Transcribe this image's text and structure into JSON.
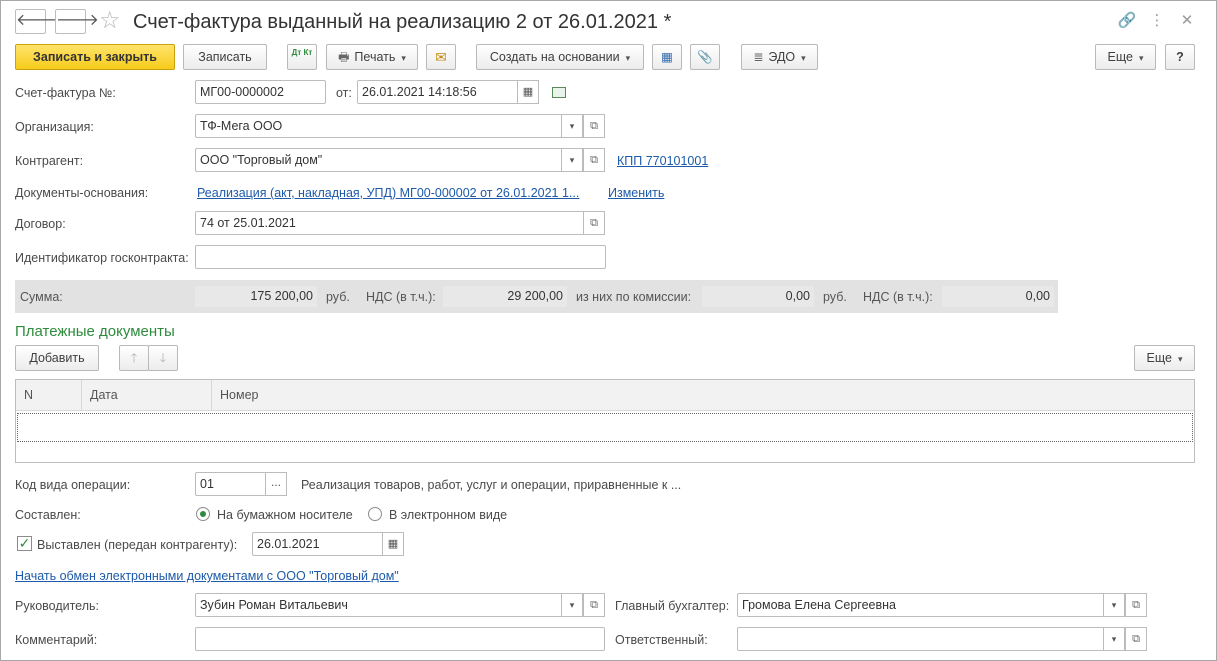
{
  "window": {
    "title": "Счет-фактура выданный на реализацию 2 от 26.01.2021 *",
    "back_glyph": "🡐",
    "forward_glyph": "🡒",
    "star_glyph": "☆",
    "link_glyph": "🔗",
    "menu_glyph": "⋮",
    "close_glyph": "✕"
  },
  "toolbar": {
    "save_close": "Записать и закрыть",
    "save": "Записать",
    "dtkt_icon": "Дт Кт",
    "print": "Печать",
    "print_glyph": "🖶",
    "mail_glyph": "✉",
    "create_based": "Создать на основании",
    "structure_glyph": "▦",
    "attach_glyph": "📎",
    "edo": "ЭДО",
    "edo_glyph": "≣",
    "more": "Еще",
    "help": "?",
    "caret": "▾"
  },
  "form": {
    "invoice_no_label": "Счет-фактура №:",
    "invoice_no": "МГ00-0000002",
    "from_label": "от:",
    "date": "26.01.2021 14:18:56",
    "calendar_glyph": "▦",
    "org_label": "Организация:",
    "org": "ТФ-Мега ООО",
    "counterparty_label": "Контрагент:",
    "counterparty": "ООО \"Торговый дом\"",
    "kpp_link": "КПП 770101001",
    "basis_label": "Документы-основания:",
    "basis_link": "Реализация (акт, накладная, УПД) МГ00-000002 от 26.01.2021 1...",
    "change_link": "Изменить",
    "contract_label": "Договор:",
    "contract": "74 от 25.01.2021",
    "gov_contract_label": "Идентификатор госконтракта:",
    "gov_contract": "",
    "open_glyph": "⧉",
    "dots": "..."
  },
  "totals": {
    "sum_label": "Сумма:",
    "sum": "175 200,00",
    "currency": "руб.",
    "vat_label": "НДС (в т.ч.):",
    "vat": "29 200,00",
    "commission_label": "из них по комиссии:",
    "commission": "0,00",
    "currency2": "руб.",
    "vat2_label": "НДС (в т.ч.):",
    "vat2": "0,00"
  },
  "payments": {
    "title": "Платежные документы",
    "add": "Добавить",
    "up_glyph": "🡑",
    "down_glyph": "🡓",
    "more": "Еще",
    "columns": [
      "N",
      "Дата",
      "Номер"
    ]
  },
  "operation": {
    "code_label": "Код вида операции:",
    "code": "01",
    "code_desc": "Реализация товаров, работ, услуг и операции, приравненные к ...",
    "composed_label": "Составлен:",
    "paper": "На бумажном носителе",
    "electronic": "В электронном виде",
    "issued_label": "Выставлен (передан контрагенту):",
    "issued_check": "✓",
    "issued_date": "26.01.2021",
    "exchange_link": "Начать обмен электронными документами с ООО \"Торговый дом\""
  },
  "signers": {
    "head_label": "Руководитель:",
    "head": "Зубин Роман Витальевич",
    "chief_acc_label": "Главный бухгалтер:",
    "chief_acc": "Громова Елена Сергеевна",
    "comment_label": "Комментарий:",
    "comment": "",
    "responsible_label": "Ответственный:",
    "responsible": ""
  }
}
